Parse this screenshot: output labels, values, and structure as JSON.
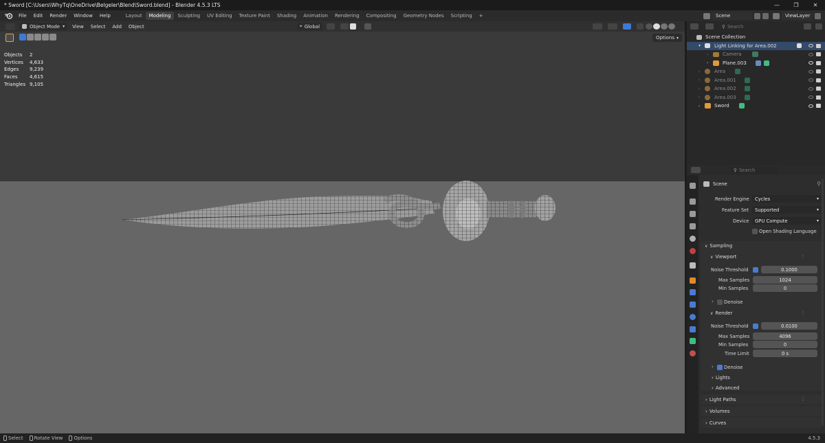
{
  "window": {
    "title": "* Sword [C:\\Users\\WhyTq\\OneDrive\\Belgeler\\Blend\\Sword.blend] - Blender 4.5.3 LTS",
    "controls": [
      "—",
      "❐",
      "✕"
    ]
  },
  "menus": [
    "File",
    "Edit",
    "Render",
    "Window",
    "Help"
  ],
  "workspaces": [
    {
      "label": "Layout",
      "active": false
    },
    {
      "label": "Modeling",
      "active": true
    },
    {
      "label": "Sculpting",
      "active": false
    },
    {
      "label": "UV Editing",
      "active": false
    },
    {
      "label": "Texture Paint",
      "active": false
    },
    {
      "label": "Shading",
      "active": false
    },
    {
      "label": "Animation",
      "active": false
    },
    {
      "label": "Rendering",
      "active": false
    },
    {
      "label": "Compositing",
      "active": false
    },
    {
      "label": "Geometry Nodes",
      "active": false
    },
    {
      "label": "Scripting",
      "active": false
    }
  ],
  "add_workspace": "+",
  "scene_selector": "Scene",
  "viewlayer_selector": "ViewLayer",
  "viewport": {
    "mode": "Object Mode",
    "menus": [
      "View",
      "Select",
      "Add",
      "Object"
    ],
    "transform_orientation": "Global",
    "options_label": "Options",
    "stats": [
      {
        "key": "Objects",
        "value": "2"
      },
      {
        "key": "Vertices",
        "value": "4,633"
      },
      {
        "key": "Edges",
        "value": "9,239"
      },
      {
        "key": "Faces",
        "value": "4,615"
      },
      {
        "key": "Triangles",
        "value": "9,105"
      }
    ]
  },
  "outliner": {
    "search_placeholder": "Search",
    "root": "Scene Collection",
    "items": [
      {
        "label": "Light Linking for Area.002",
        "level": 1,
        "dim": false,
        "selected": true
      },
      {
        "label": "Camera",
        "level": 2,
        "dim": true,
        "selected": false
      },
      {
        "label": "Plane.003",
        "level": 2,
        "dim": false,
        "selected": false
      },
      {
        "label": "Area",
        "level": 1,
        "dim": true,
        "selected": false
      },
      {
        "label": "Area.001",
        "level": 1,
        "dim": true,
        "selected": false
      },
      {
        "label": "Area.002",
        "level": 1,
        "dim": true,
        "selected": false
      },
      {
        "label": "Area.003",
        "level": 1,
        "dim": true,
        "selected": false
      },
      {
        "label": "Sword",
        "level": 1,
        "dim": false,
        "selected": false
      }
    ]
  },
  "properties": {
    "search_placeholder": "Search",
    "context": "Scene",
    "render_engine_label": "Render Engine",
    "render_engine": "Cycles",
    "feature_set_label": "Feature Set",
    "feature_set": "Supported",
    "device_label": "Device",
    "device": "GPU Compute",
    "osl_label": "Open Shading Language",
    "sampling": "Sampling",
    "viewport_panel": {
      "title": "Viewport",
      "noise_threshold_label": "Noise Threshold",
      "noise_threshold": "0.1000",
      "max_samples_label": "Max Samples",
      "max_samples": "1024",
      "min_samples_label": "Min Samples",
      "min_samples": "0",
      "denoise_label": "Denoise"
    },
    "render_panel": {
      "title": "Render",
      "noise_threshold_label": "Noise Threshold",
      "noise_threshold": "0.0100",
      "max_samples_label": "Max Samples",
      "max_samples": "4096",
      "min_samples_label": "Min Samples",
      "min_samples": "0",
      "time_limit_label": "Time Limit",
      "time_limit": "0 s",
      "denoise_label": "Denoise"
    },
    "lights_label": "Lights",
    "advanced_label": "Advanced",
    "light_paths_label": "Light Paths",
    "volumes_label": "Volumes",
    "curves_label": "Curves"
  },
  "statusbar": {
    "items": [
      "Select",
      "Rotate View",
      "Options"
    ],
    "version": "4.5.3"
  }
}
